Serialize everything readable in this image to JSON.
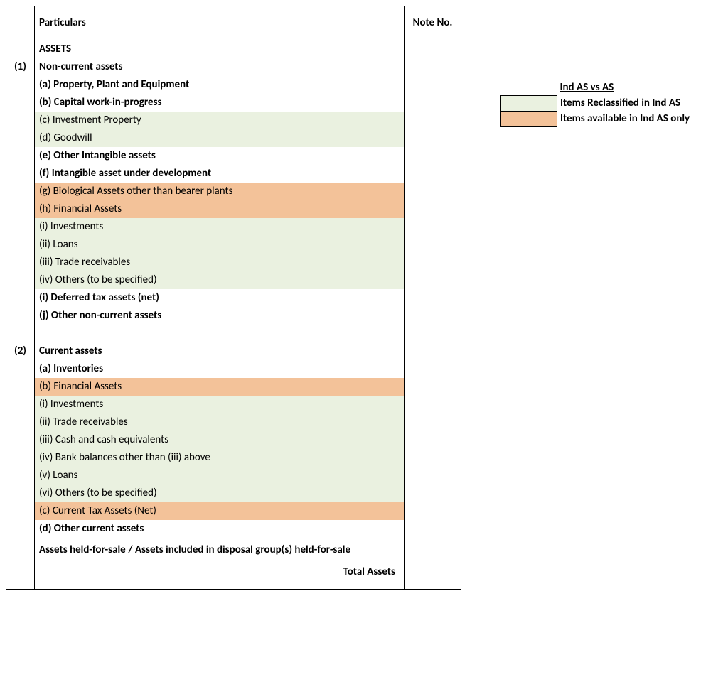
{
  "colors": {
    "reclassified": "#eaf1e0",
    "indASonly": "#f3c299"
  },
  "headers": {
    "particulars": "Particulars",
    "noteNo": "Note No."
  },
  "sections": {
    "num1": "(1)",
    "num2": "(2)",
    "assets": "ASSETS",
    "nonCurrent": "Non-current assets",
    "a_ppe": "(a) Property, Plant and Equipment",
    "b_cwip": "(b) Capital work-in-progress",
    "c_invProp": "(c) Investment Property",
    "d_goodwill": "(d) Goodwill",
    "e_otherIntang": "(e) Other Intangible assets",
    "f_intangDev": "(f) Intangible asset under development",
    "g_bio": "(g) Biological Assets other than bearer plants",
    "h_finAssets": "(h) Financial Assets",
    "h_i": "(i) Investments",
    "h_ii": "(ii) Loans",
    "h_iii": "(iii) Trade receivables",
    "h_iv": "(iv) Others (to be specified)",
    "i_dta": "(i) Deferred tax assets (net)",
    "j_otherNC": "(j) Other non-current assets",
    "current": "Current assets",
    "ca_a_inv": "(a) Inventories",
    "ca_b_fin": "(b) Financial Assets",
    "ca_b_i": "(i) Investments",
    "ca_b_ii": "(ii) Trade receivables",
    "ca_b_iii": "(iii) Cash and cash equivalents",
    "ca_b_iv": "(iv) Bank balances other than (iii) above",
    "ca_b_v": "(v) Loans",
    "ca_b_vi": "(vi) Others (to be specified)",
    "ca_c_tax": "(c) Current Tax Assets (Net)",
    "ca_d_other": "(d) Other current assets",
    "heldForSale": "Assets held-for-sale / Assets included in disposal group(s) held-for-sale",
    "totalAssets": "Total Assets"
  },
  "legend": {
    "title": "Ind AS vs AS",
    "reclassified": "Items Reclassified in Ind AS",
    "indASonly": "Items available in Ind AS only"
  }
}
